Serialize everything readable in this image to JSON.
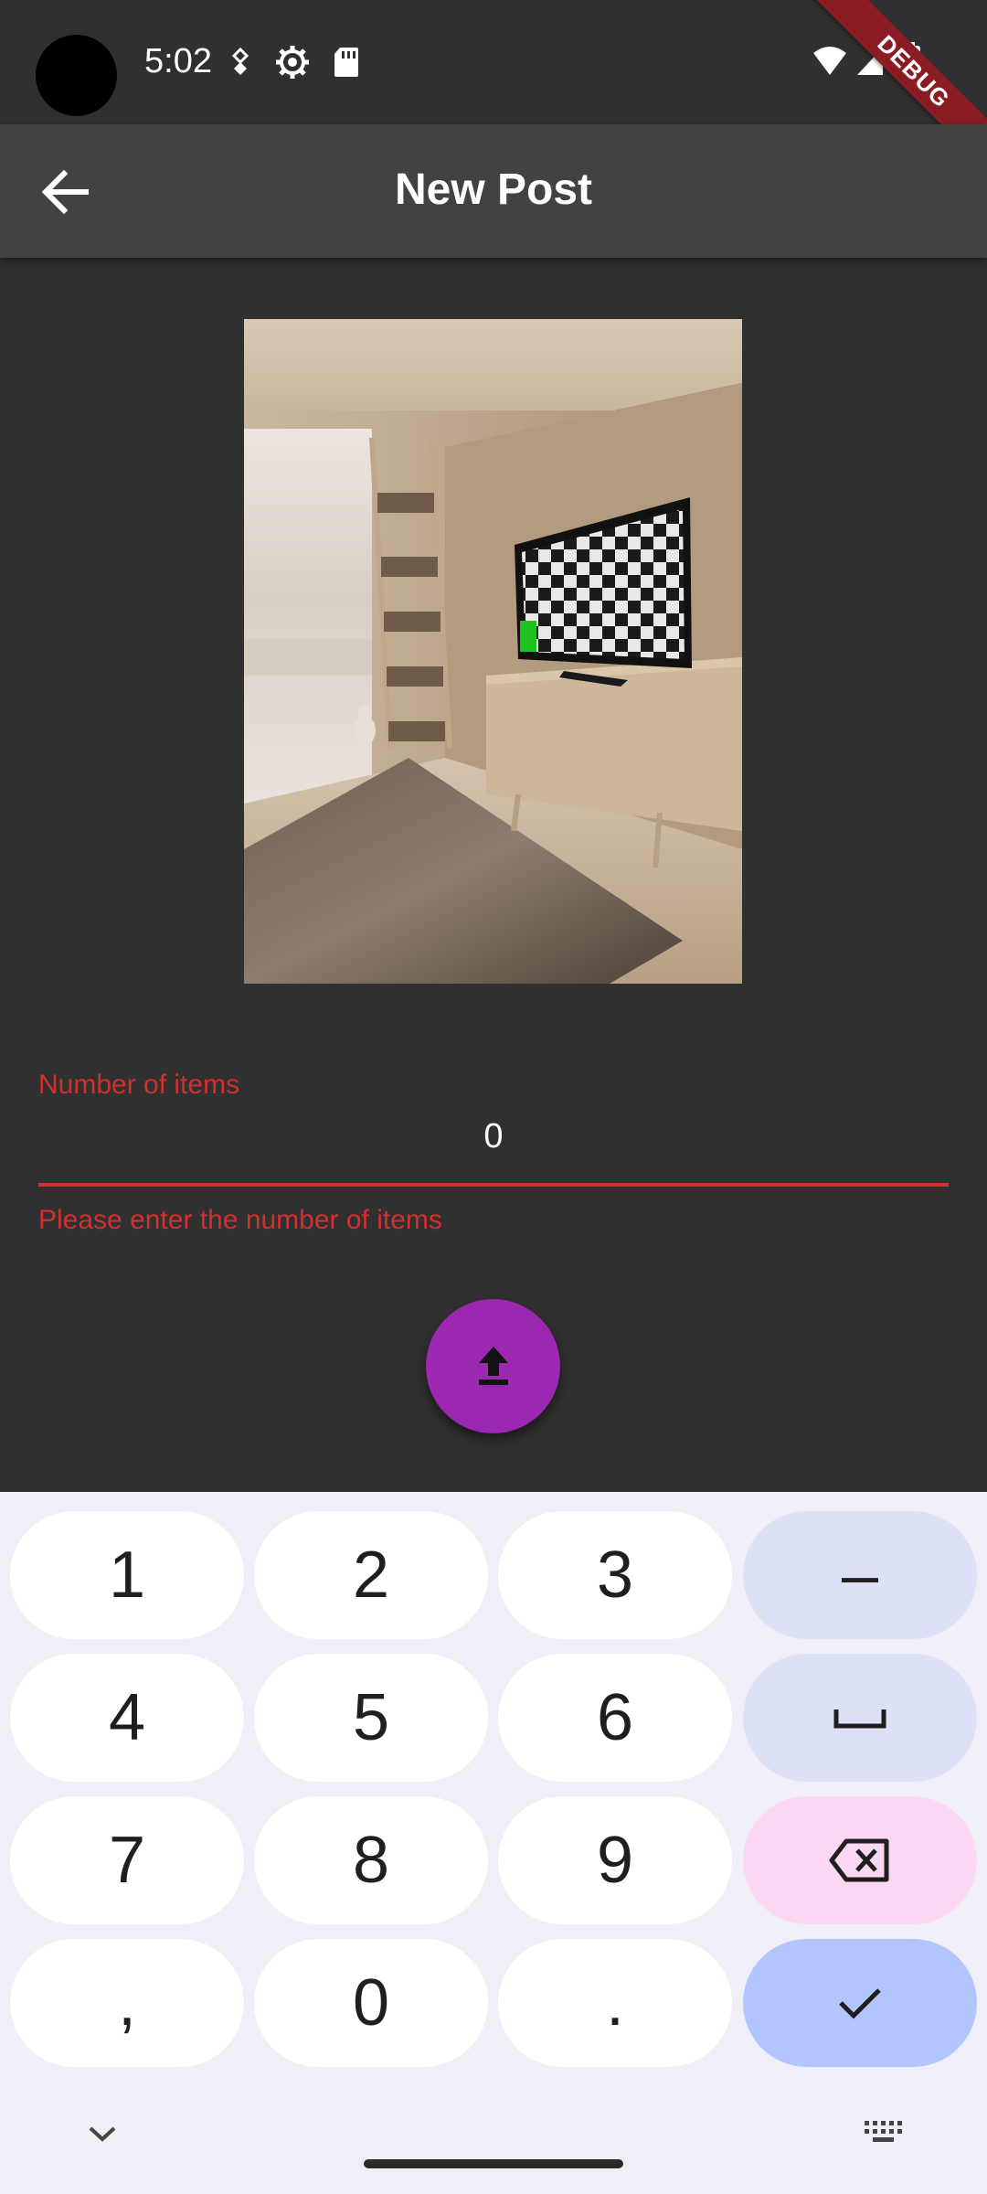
{
  "status_bar": {
    "time": "5:02"
  },
  "debug_banner": "DEBUG",
  "appbar": {
    "title": "New Post"
  },
  "form": {
    "label": "Number of items",
    "value": "0",
    "error": "Please enter the number of items"
  },
  "fab": {
    "icon": "upload-icon"
  },
  "keyboard": {
    "keys": [
      "1",
      "2",
      "3",
      "–",
      "4",
      "5",
      "6",
      "␣",
      "7",
      "8",
      "9",
      "⌫",
      ",",
      "0",
      ".",
      "✓"
    ]
  },
  "colors": {
    "background": "#303030",
    "appbar": "#424242",
    "error": "#d32f2f",
    "fab": "#9c27b0",
    "keyboard_bg": "#f0eef6"
  }
}
